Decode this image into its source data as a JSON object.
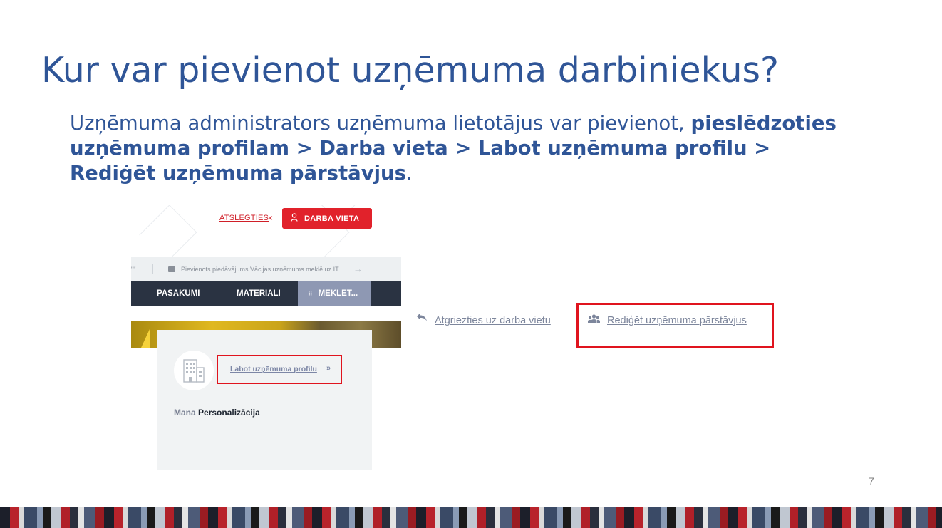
{
  "slide": {
    "title": "Kur var pievienot uzņēmuma darbiniekus?",
    "body_lead": "Uzņēmuma administrators uzņēmuma lietotājus var pievienot, ",
    "body_bold": "pieslēdzoties uzņēmuma profilam > Darba vieta > Labot uzņēmuma profilu > Rediģēt uzņēmuma pārstāvjus",
    "body_end": ".",
    "page_number": "7"
  },
  "left_screenshot": {
    "header": {
      "logout_label": "ATSLĒGTIES",
      "logout_x": "×",
      "workplace_icon": "person-icon",
      "workplace_button": "DARBA VIETA"
    },
    "ticker": {
      "fragment": "\"\"",
      "bag_icon": "briefcase-icon",
      "text": "Pievienots piedāvājums Vācijas uzņēmums meklē uz IT",
      "arrow": "→"
    },
    "nav": {
      "item1": "PASĀKUMI",
      "item2": "MATERIĀLI",
      "search_icon": "grid-icon",
      "search": "MEKLĒT..."
    },
    "card": {
      "building_icon": "building-icon",
      "edit_profile_link": "Labot uzņēmuma profilu",
      "edit_profile_chevron": "»",
      "mana_label": "Mana",
      "personalization_label": "Personalizācija"
    }
  },
  "right_screenshot": {
    "back_icon": "reply-arrow-icon",
    "back_link": "Atgriezties uz darba vietu",
    "reps_icon": "people-icon",
    "edit_reps_link": "Rediģēt uzņēmuma pārstāvjus"
  },
  "colors": {
    "title_blue": "#2f5597",
    "highlight_red": "#e0141e",
    "button_red": "#e1222b",
    "nav_dark": "#2a3342",
    "nav_search": "#8e98b3",
    "link_gray": "#7d869c"
  }
}
